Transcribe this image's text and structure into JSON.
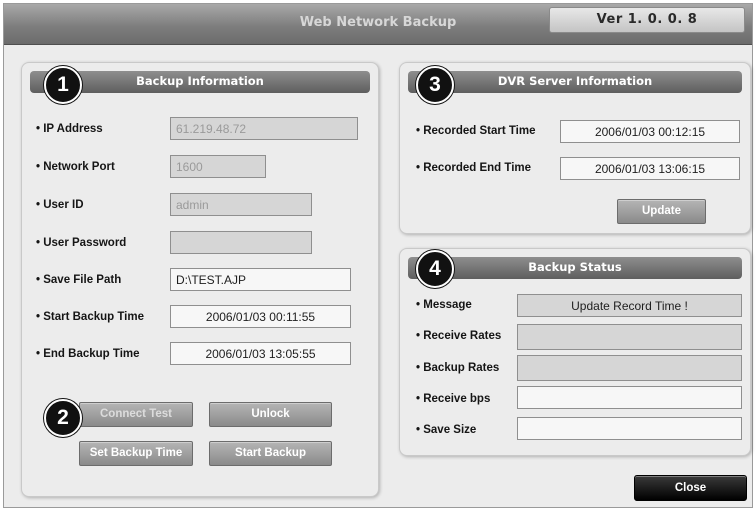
{
  "window": {
    "title": "Web Network Backup",
    "version": "Ver 1. 0. 0. 8"
  },
  "backup_info": {
    "number": "1",
    "title": "Backup Information",
    "fields": {
      "ip_address": {
        "label": "IP Address",
        "value": "61.219.48.72"
      },
      "network_port": {
        "label": "Network Port",
        "value": "1600"
      },
      "user_id": {
        "label": "User ID",
        "value": "admin"
      },
      "user_password": {
        "label": "User Password",
        "value": ""
      },
      "save_file_path": {
        "label": "Save File Path",
        "value": "D:\\TEST.AJP"
      },
      "start_backup_time": {
        "label": "Start Backup Time",
        "value": "2006/01/03 00:11:55"
      },
      "end_backup_time": {
        "label": "End Backup Time",
        "value": "2006/01/03 13:05:55"
      }
    }
  },
  "controls": {
    "number": "2",
    "connect_test": "Connect Test",
    "unlock": "Unlock",
    "set_backup_time": "Set Backup Time",
    "start_backup": "Start Backup"
  },
  "dvr_info": {
    "number": "3",
    "title": "DVR Server Information",
    "recorded_start": {
      "label": "Recorded Start Time",
      "value": "2006/01/03 00:12:15"
    },
    "recorded_end": {
      "label": "Recorded End Time",
      "value": "2006/01/03 13:06:15"
    },
    "update_label": "Update"
  },
  "backup_status": {
    "number": "4",
    "title": "Backup Status",
    "message": {
      "label": "Message",
      "value": "Update Record Time !"
    },
    "receive_rates": {
      "label": "Receive Rates",
      "value": ""
    },
    "backup_rates": {
      "label": "Backup Rates",
      "value": ""
    },
    "receive_bps": {
      "label": "Receive bps",
      "value": ""
    },
    "save_size": {
      "label": "Save Size",
      "value": ""
    }
  },
  "close_label": "Close"
}
